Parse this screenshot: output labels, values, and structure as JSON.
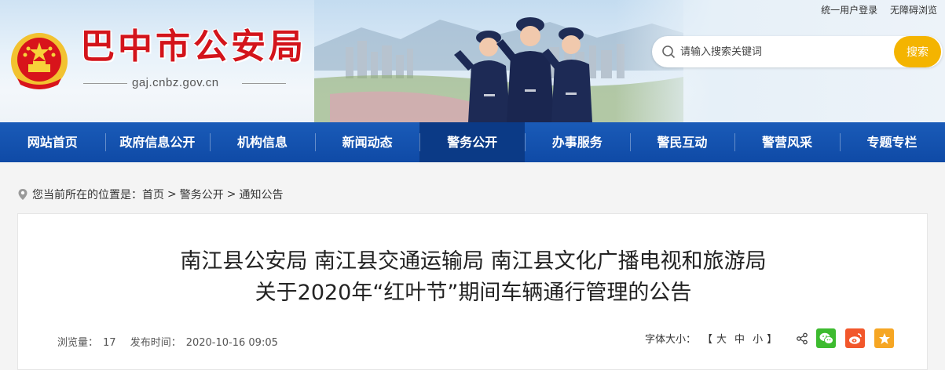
{
  "top_links": {
    "login": "统一用户登录",
    "barrier_free": "无障碍浏览"
  },
  "site": {
    "title": "巴中市公安局",
    "domain": "gaj.cnbz.gov.cn"
  },
  "search": {
    "placeholder": "请输入搜索关键词",
    "button": "搜索"
  },
  "nav": {
    "items": [
      {
        "label": "网站首页"
      },
      {
        "label": "政府信息公开"
      },
      {
        "label": "机构信息"
      },
      {
        "label": "新闻动态"
      },
      {
        "label": "警务公开",
        "active": true
      },
      {
        "label": "办事服务"
      },
      {
        "label": "警民互动"
      },
      {
        "label": "警营风采"
      },
      {
        "label": "专题专栏"
      }
    ]
  },
  "breadcrumb": {
    "prefix": "您当前所在的位置是：",
    "home": "首页",
    "level1": "警务公开",
    "level2": "通知公告",
    "sep1": ">",
    "sep2": ">"
  },
  "article": {
    "title_line1": "南江县公安局 南江县交通运输局 南江县文化广播电视和旅游局",
    "title_line2": "关于2020年“红叶节”期间车辆通行管理的公告",
    "views_label": "浏览量：",
    "views": "17",
    "publish_label": "发布时间：",
    "publish_time": "2020-10-16 09:05",
    "font_size_label": "字体大小：",
    "bracket_open": "【",
    "font_large": "大",
    "font_medium": "中",
    "font_small": "小",
    "bracket_close": "】"
  },
  "icons": {
    "share": "share-icon",
    "wechat": "wechat-icon",
    "weibo": "weibo-icon",
    "favorite": "star-icon"
  },
  "colors": {
    "brand_red": "#d3141b",
    "nav_blue": "#1256b0",
    "nav_active": "#0b3a86",
    "search_button": "#f4b400",
    "wechat": "#3dbb2f",
    "weibo": "#f2572b",
    "favorite": "#f6a623"
  }
}
